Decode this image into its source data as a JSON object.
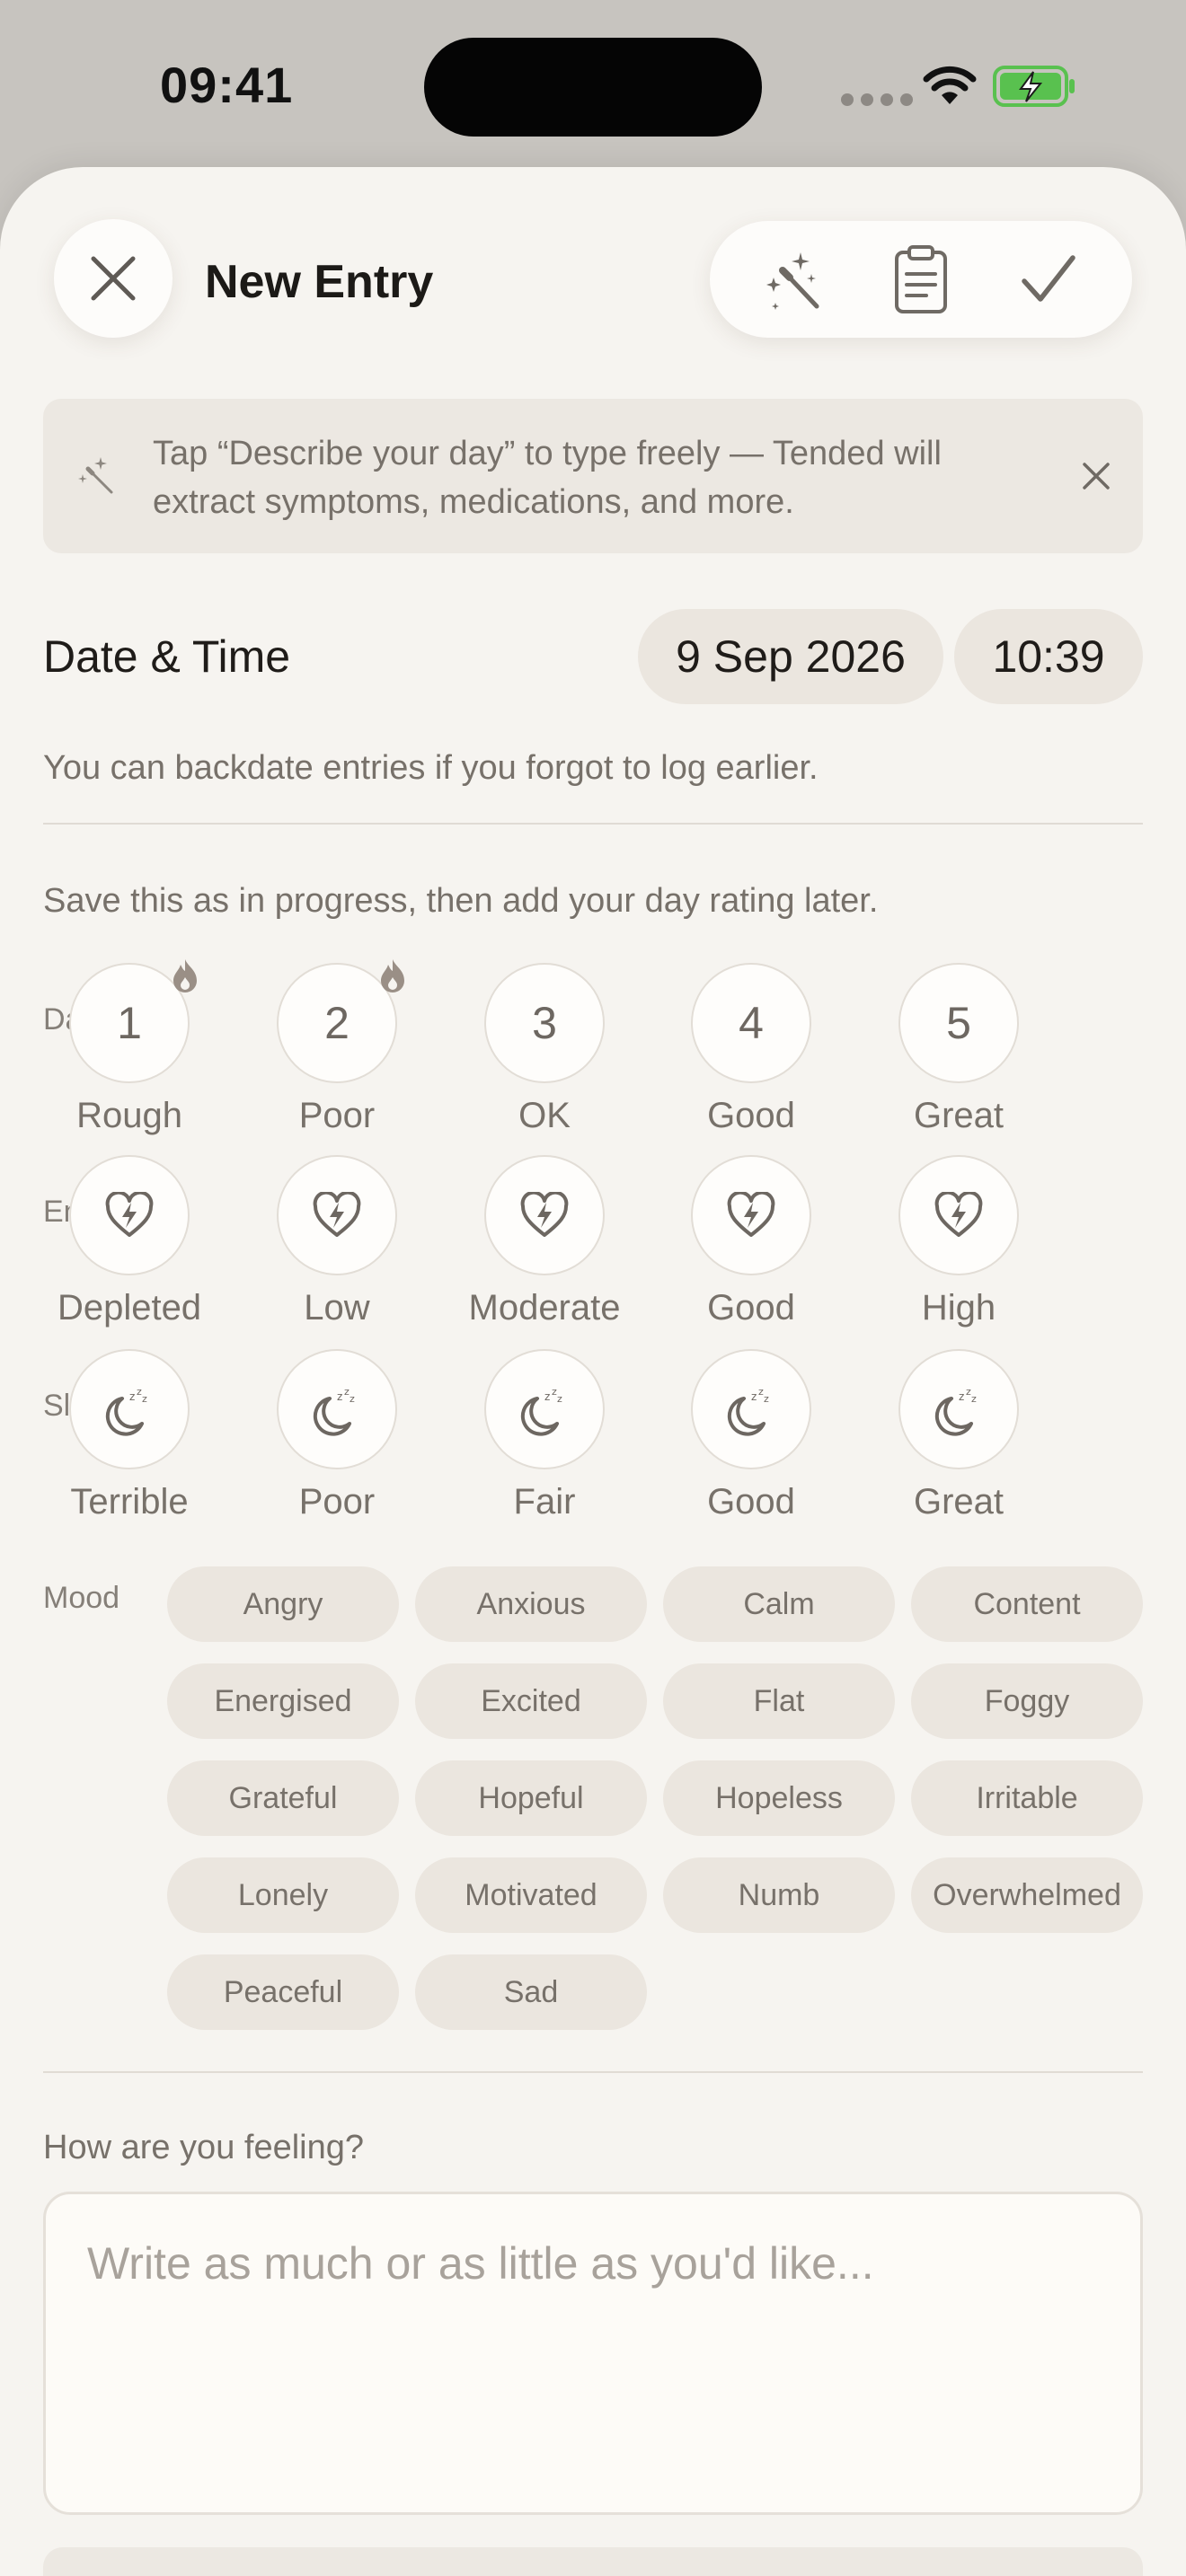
{
  "status": {
    "time": "09:41"
  },
  "header": {
    "title": "New Entry"
  },
  "tip": {
    "text": "Tap “Describe your day” to type freely — Tended will extract symptoms, medications, and more."
  },
  "datetime": {
    "label": "Date & Time",
    "date": "9 Sep 2026",
    "time": "10:39",
    "hint": "You can backdate entries if you forgot to log earlier."
  },
  "progress_hint": "Save this as in progress, then add your day rating later.",
  "day": {
    "label": "Day",
    "options": [
      {
        "value": "1",
        "label": "Rough",
        "flagged": true
      },
      {
        "value": "2",
        "label": "Poor",
        "flagged": true
      },
      {
        "value": "3",
        "label": "OK",
        "flagged": false
      },
      {
        "value": "4",
        "label": "Good",
        "flagged": false
      },
      {
        "value": "5",
        "label": "Great",
        "flagged": false
      }
    ]
  },
  "energy": {
    "label": "Energy",
    "icon": "heart-bolt-icon",
    "options": [
      "Depleted",
      "Low",
      "Moderate",
      "Good",
      "High"
    ]
  },
  "sleep": {
    "label": "Sleep",
    "icon": "moon-zzz-icon",
    "options": [
      "Terrible",
      "Poor",
      "Fair",
      "Good",
      "Great"
    ]
  },
  "mood": {
    "label": "Mood",
    "chips": [
      "Angry",
      "Anxious",
      "Calm",
      "Content",
      "Energised",
      "Excited",
      "Flat",
      "Foggy",
      "Grateful",
      "Hopeful",
      "Hopeless",
      "Irritable",
      "Lonely",
      "Motivated",
      "Numb",
      "Overwhelmed",
      "Peaceful",
      "Sad"
    ]
  },
  "feeling": {
    "label": "How are you feeling?",
    "placeholder": "Write as much or as little as you'd like..."
  },
  "colors": {
    "background": "#f6f4f0",
    "chip": "#ebe6df",
    "text_muted": "#77716a",
    "battery_green": "#59c14f"
  }
}
